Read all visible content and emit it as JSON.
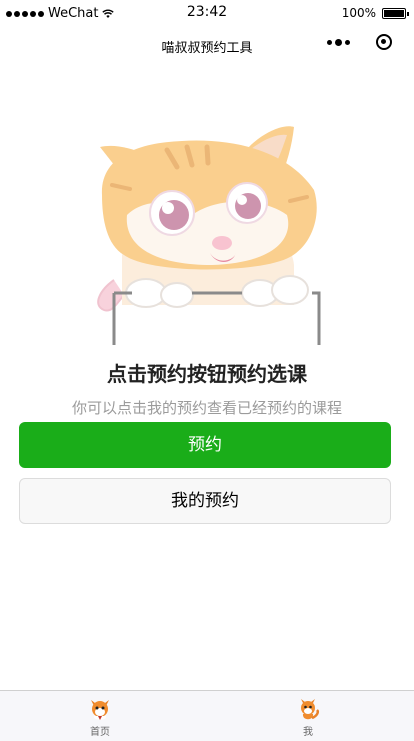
{
  "status_bar": {
    "carrier": "WeChat",
    "time": "23:42",
    "battery": "100%",
    "battery_level": 1.0
  },
  "nav": {
    "title": "喵叔叔预约工具"
  },
  "main": {
    "headline": "点击预约按钮预约选课",
    "subline": "你可以点击我的预约查看已经预约的课程",
    "primary_button": "预约",
    "secondary_button": "我的预约"
  },
  "tabs": [
    {
      "label": "首页",
      "icon": "cat-icon"
    },
    {
      "label": "我",
      "icon": "fox-icon"
    }
  ],
  "colors": {
    "primary": "#1aad19",
    "cat_orange": "#f7b34a"
  }
}
